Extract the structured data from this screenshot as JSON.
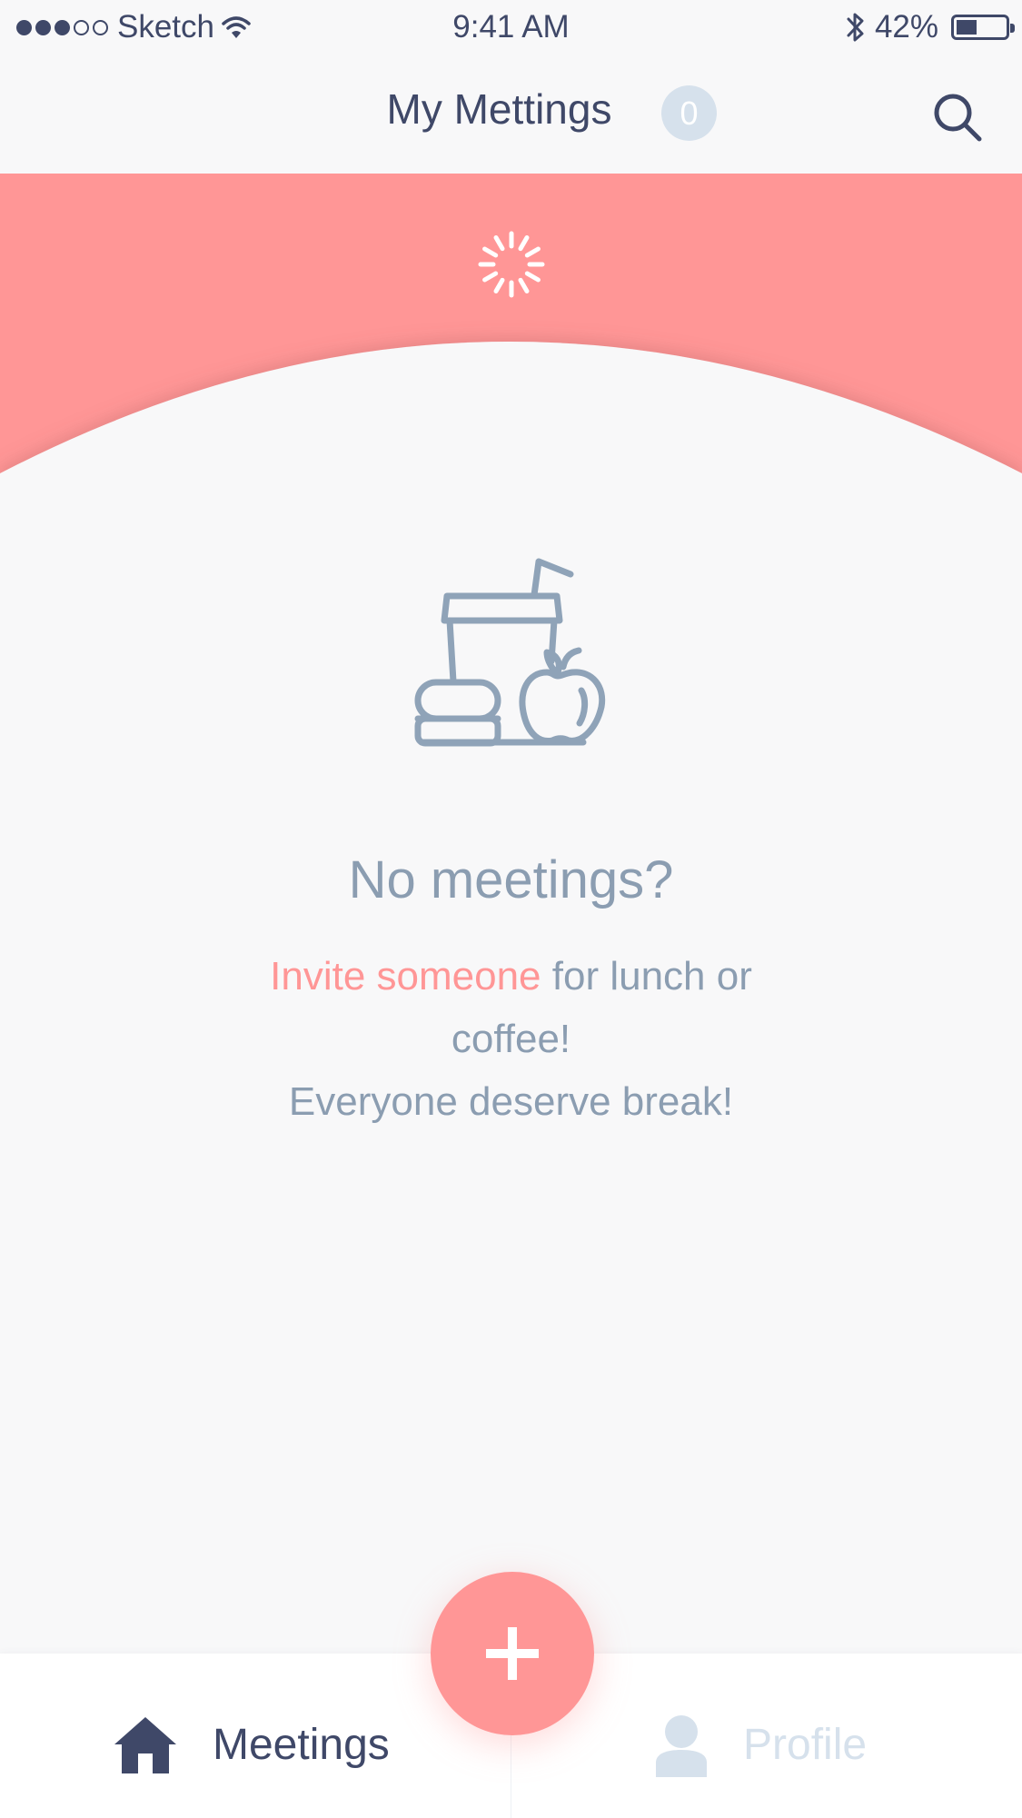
{
  "status_bar": {
    "carrier": "Sketch",
    "time": "9:41 AM",
    "battery_percent": "42%",
    "battery_level": 0.42,
    "signal_bars_filled": 3,
    "signal_bars_total": 5
  },
  "nav": {
    "title": "My Mettings",
    "badge_count": "0",
    "search_icon": "search-icon"
  },
  "hero": {
    "spinner_icon": "loading-spinner-icon"
  },
  "empty_state": {
    "illustration_icon": "food-drink-icon",
    "title": "No meetings?",
    "message_link": "Invite someone",
    "message_rest": " for lunch or coffee!",
    "message_line2": "Everyone deserve break!"
  },
  "tab_bar": {
    "meetings_label": "Meetings",
    "meetings_icon": "home-icon",
    "profile_label": "Profile",
    "profile_icon": "user-icon"
  },
  "fab": {
    "icon": "plus-icon"
  },
  "colors": {
    "accent": "#ff9696",
    "navy": "#3f4868",
    "muted": "#8b9db1",
    "inactive": "#d6e1ec",
    "background": "#f8f8f9"
  }
}
